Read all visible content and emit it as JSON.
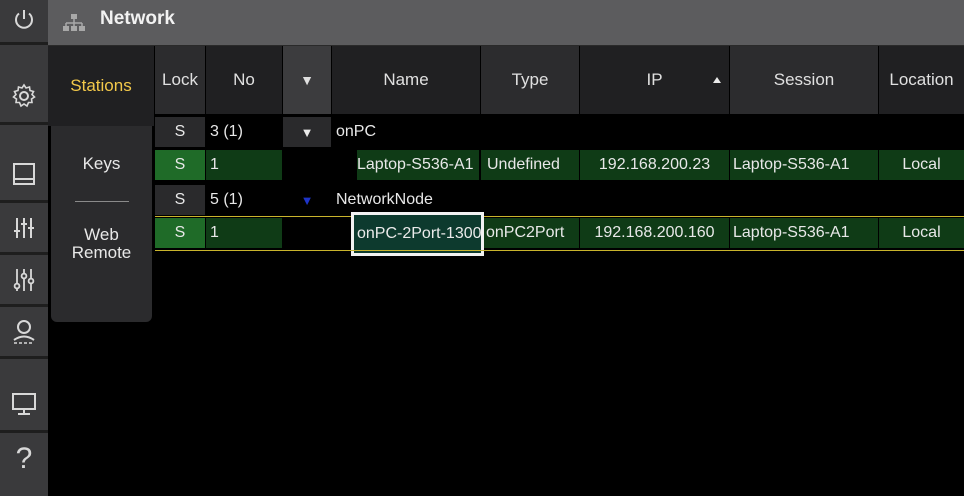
{
  "window": {
    "title": "Network"
  },
  "iconbar": {
    "icons": [
      "power-icon",
      "settings-icon",
      "window-icon",
      "faders-icon",
      "submaster-icon",
      "user-icon",
      "screen-icon",
      "help-icon"
    ],
    "help_label": "?"
  },
  "subtabs": {
    "stations_label": "Stations",
    "keys_label": "Keys",
    "web_remote_label": "Web\nRemote"
  },
  "table": {
    "headers": {
      "lock": "Lock",
      "no": "No",
      "expand": "▼",
      "name": "Name",
      "type": "Type",
      "ip": "IP",
      "session": "Session",
      "location": "Location"
    },
    "rows": [
      {
        "kind": "group",
        "lock": "S",
        "no": "3 (1)",
        "expand": "▼",
        "name": "onPC"
      },
      {
        "kind": "station",
        "lock": "S",
        "no": "1",
        "name": "Laptop-S536-A1",
        "type": "Undefined",
        "ip": "192.168.200.23",
        "session": "Laptop-S536-A1",
        "location": "Local"
      },
      {
        "kind": "group",
        "lock": "S",
        "no": "5 (1)",
        "expand": "▼",
        "name": "NetworkNode"
      },
      {
        "kind": "station",
        "lock": "S",
        "no": "1",
        "name": "onPC-2Port-1300",
        "type": "onPC2Port",
        "ip": "192.168.200.160",
        "session": "Laptop-S536-A1",
        "location": "Local",
        "selected": true
      }
    ]
  },
  "colors": {
    "accent": "#f3c94a",
    "station_row": "#0f3b16",
    "lock_green": "#1f6b28",
    "selection_line": "#c9b42c"
  }
}
